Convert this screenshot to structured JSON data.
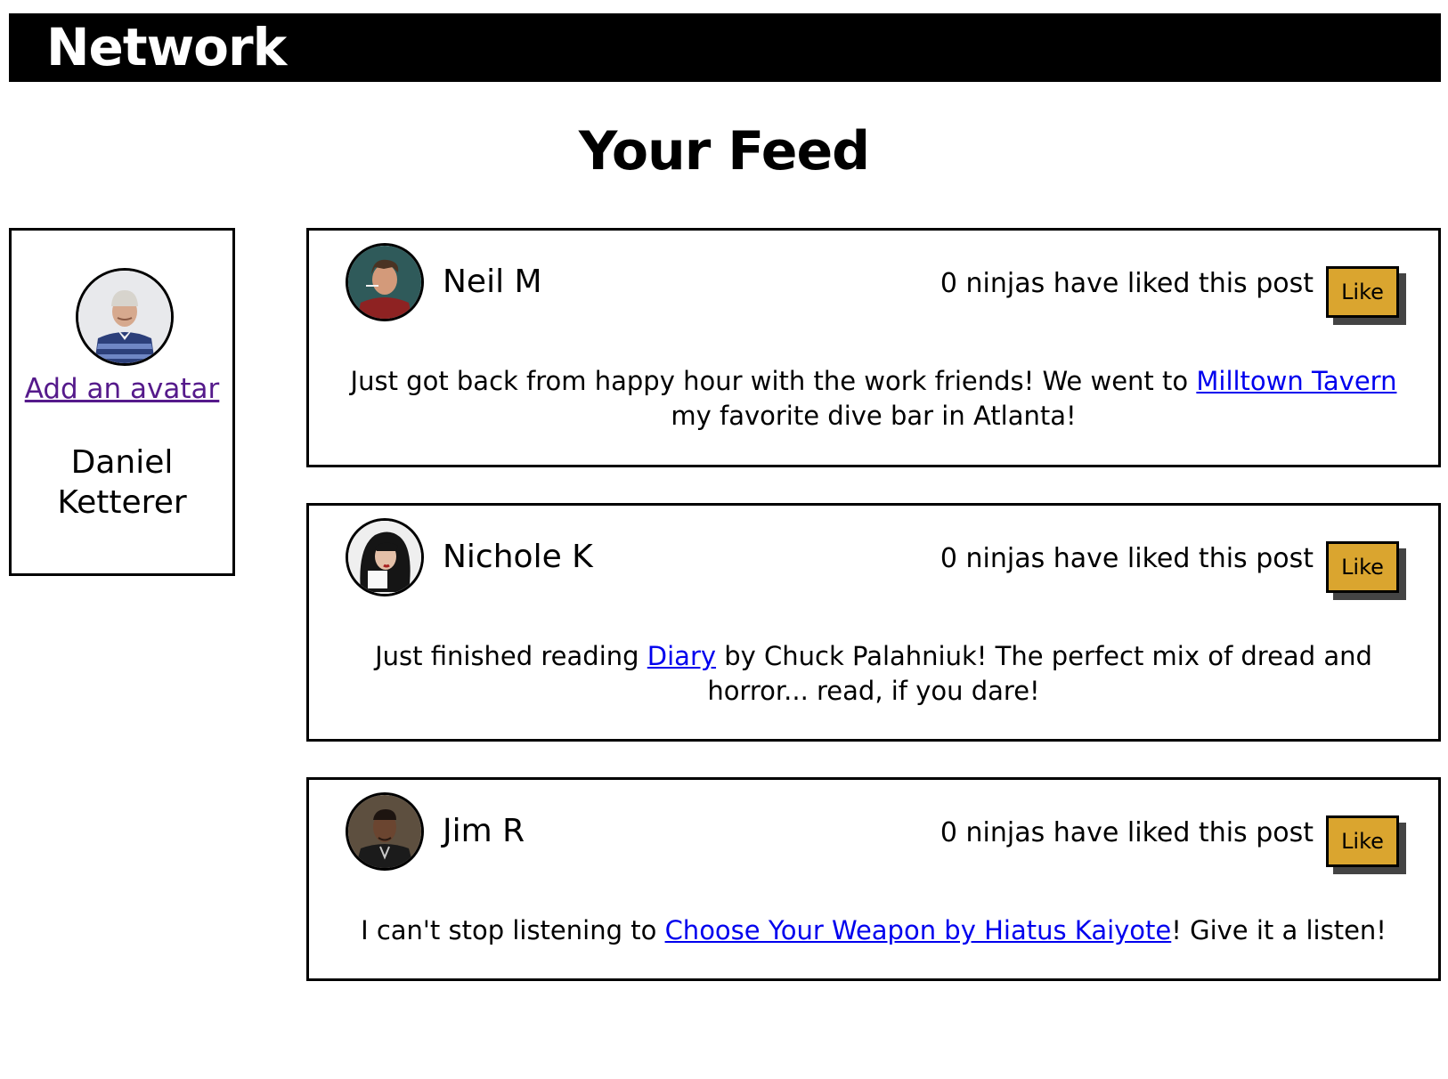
{
  "header": {
    "brand": "Network"
  },
  "feed": {
    "title": "Your Feed"
  },
  "profile": {
    "avatar_link": "Add an avatar",
    "name": "Daniel Ketterer"
  },
  "posts": [
    {
      "author": "Neil M",
      "likes_text": "0 ninjas have liked this post",
      "like_label": "Like",
      "text_before": "Just got back from happy hour with the work friends! We went to ",
      "link": "Milltown Tavern",
      "text_after": " my favorite dive bar in Atlanta!"
    },
    {
      "author": "Nichole K",
      "likes_text": "0 ninjas have liked this post",
      "like_label": "Like",
      "text_before": "Just finished reading ",
      "link": "Diary",
      "text_after": " by Chuck Palahniuk! The perfect mix of dread and horror... read, if you dare!"
    },
    {
      "author": "Jim R",
      "likes_text": "0 ninjas have liked this post",
      "like_label": "Like",
      "text_before": "I can't stop listening to ",
      "link": "Choose Your Weapon by Hiatus Kaiyote",
      "text_after": "! Give it a listen!"
    }
  ],
  "colors": {
    "header_bg": "#000000",
    "like_button": "#daa52f",
    "link": "#0000ee",
    "visited_link": "#551a8b"
  }
}
